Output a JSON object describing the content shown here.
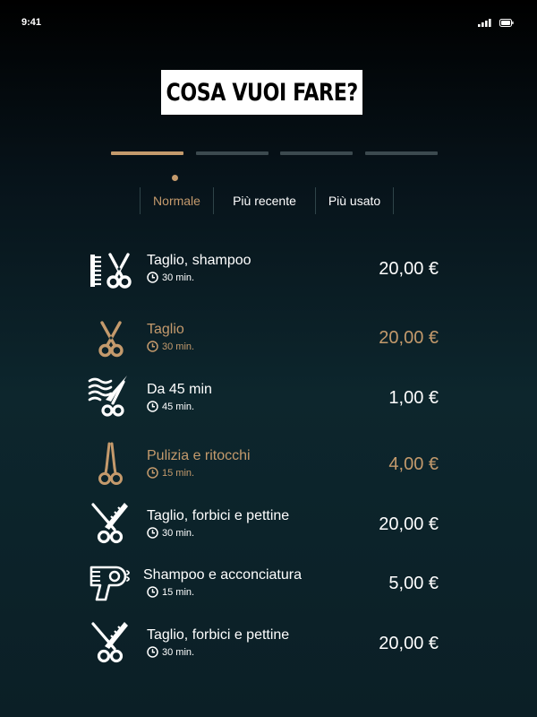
{
  "status_bar": {
    "time": "9:41",
    "icons": [
      "signal-icon",
      "battery-icon"
    ]
  },
  "header": {
    "title": "COSA VUOI FARE?"
  },
  "steps": {
    "total": 4,
    "current": 1,
    "colors": {
      "active": "#c49a6c",
      "inactive": "#3c4a4f"
    }
  },
  "sort_tabs": [
    {
      "label": "Normale",
      "active": true
    },
    {
      "label": "Più recente",
      "active": false
    },
    {
      "label": "Più usato",
      "active": false
    }
  ],
  "colors": {
    "accent": "#c49a6c",
    "text": "#ffffff",
    "divider": "#2f4449"
  },
  "services": [
    {
      "icon": "comb-scissors-icon",
      "name": "Taglio, shampoo",
      "duration": "30 min.",
      "price": "20,00 €",
      "highlighted": false
    },
    {
      "icon": "scissors-icon",
      "name": "Taglio",
      "duration": "30 min.",
      "price": "20,00 €",
      "highlighted": true
    },
    {
      "icon": "cutting-hair-icon",
      "name": "Da 45 min",
      "duration": "45 min.",
      "price": "1,00 €",
      "highlighted": false
    },
    {
      "icon": "trimming-scissors-icon",
      "name": "Pulizia e ritocchi",
      "duration": "15 min.",
      "price": "4,00 €",
      "highlighted": true
    },
    {
      "icon": "scissors-comb-icon",
      "name": "Taglio, forbici e pettine",
      "duration": "30 min.",
      "price": "20,00 €",
      "highlighted": false
    },
    {
      "icon": "hair-dryer-icon",
      "name": "Shampoo e acconciatura",
      "duration": "15 min.",
      "price": "5,00 €",
      "highlighted": false
    },
    {
      "icon": "scissors-comb-icon",
      "name": "Taglio, forbici e pettine",
      "duration": "30 min.",
      "price": "20,00 €",
      "highlighted": false
    }
  ]
}
